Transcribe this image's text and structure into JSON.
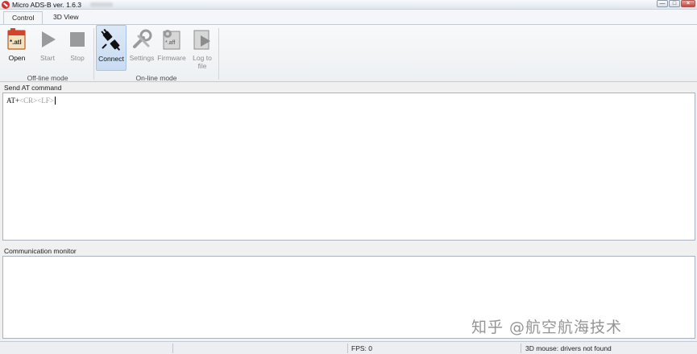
{
  "window": {
    "title": "Micro ADS-B ver. 1.6.3",
    "controls": {
      "minimize": "—",
      "maximize": "□",
      "close": "×"
    }
  },
  "tabs": [
    {
      "label": "Control",
      "active": true
    },
    {
      "label": "3D View",
      "active": false
    }
  ],
  "ribbon": {
    "groups": [
      {
        "label": "Off-line mode",
        "buttons": [
          {
            "label": "Open",
            "icon": "atl-file-icon",
            "icon_text": "*.atl",
            "enabled": true
          },
          {
            "label": "Start",
            "icon": "play-icon",
            "enabled": false
          },
          {
            "label": "Stop",
            "icon": "stop-icon",
            "enabled": false
          }
        ]
      },
      {
        "label": "On-line mode",
        "buttons": [
          {
            "label": "Connect",
            "icon": "plug-connect-icon",
            "enabled": true,
            "pressed": true
          },
          {
            "label": "Settings",
            "icon": "wrench-settings-icon",
            "enabled": false
          },
          {
            "label": "Firmware",
            "icon": "aff-file-gear-icon",
            "icon_text": "*.aff",
            "enabled": false
          },
          {
            "label": "Log to\nfile",
            "label_line1": "Log to",
            "label_line2": "file",
            "icon": "log-file-play-icon",
            "enabled": false
          }
        ]
      }
    ]
  },
  "send_panel": {
    "header": "Send AT command",
    "input_prefix": "AT+",
    "input_suffix": "<CR><LF>"
  },
  "monitor_panel": {
    "header": "Communication monitor",
    "content": ""
  },
  "status_bar": {
    "fps": "FPS: 0",
    "mouse": "3D mouse: drivers not found"
  },
  "watermark": "知乎 @航空航海技术",
  "colors": {
    "pressed_bg": "#c9dcf2",
    "title_bg": "#dfe6ee",
    "close_btn": "#c9423a"
  }
}
